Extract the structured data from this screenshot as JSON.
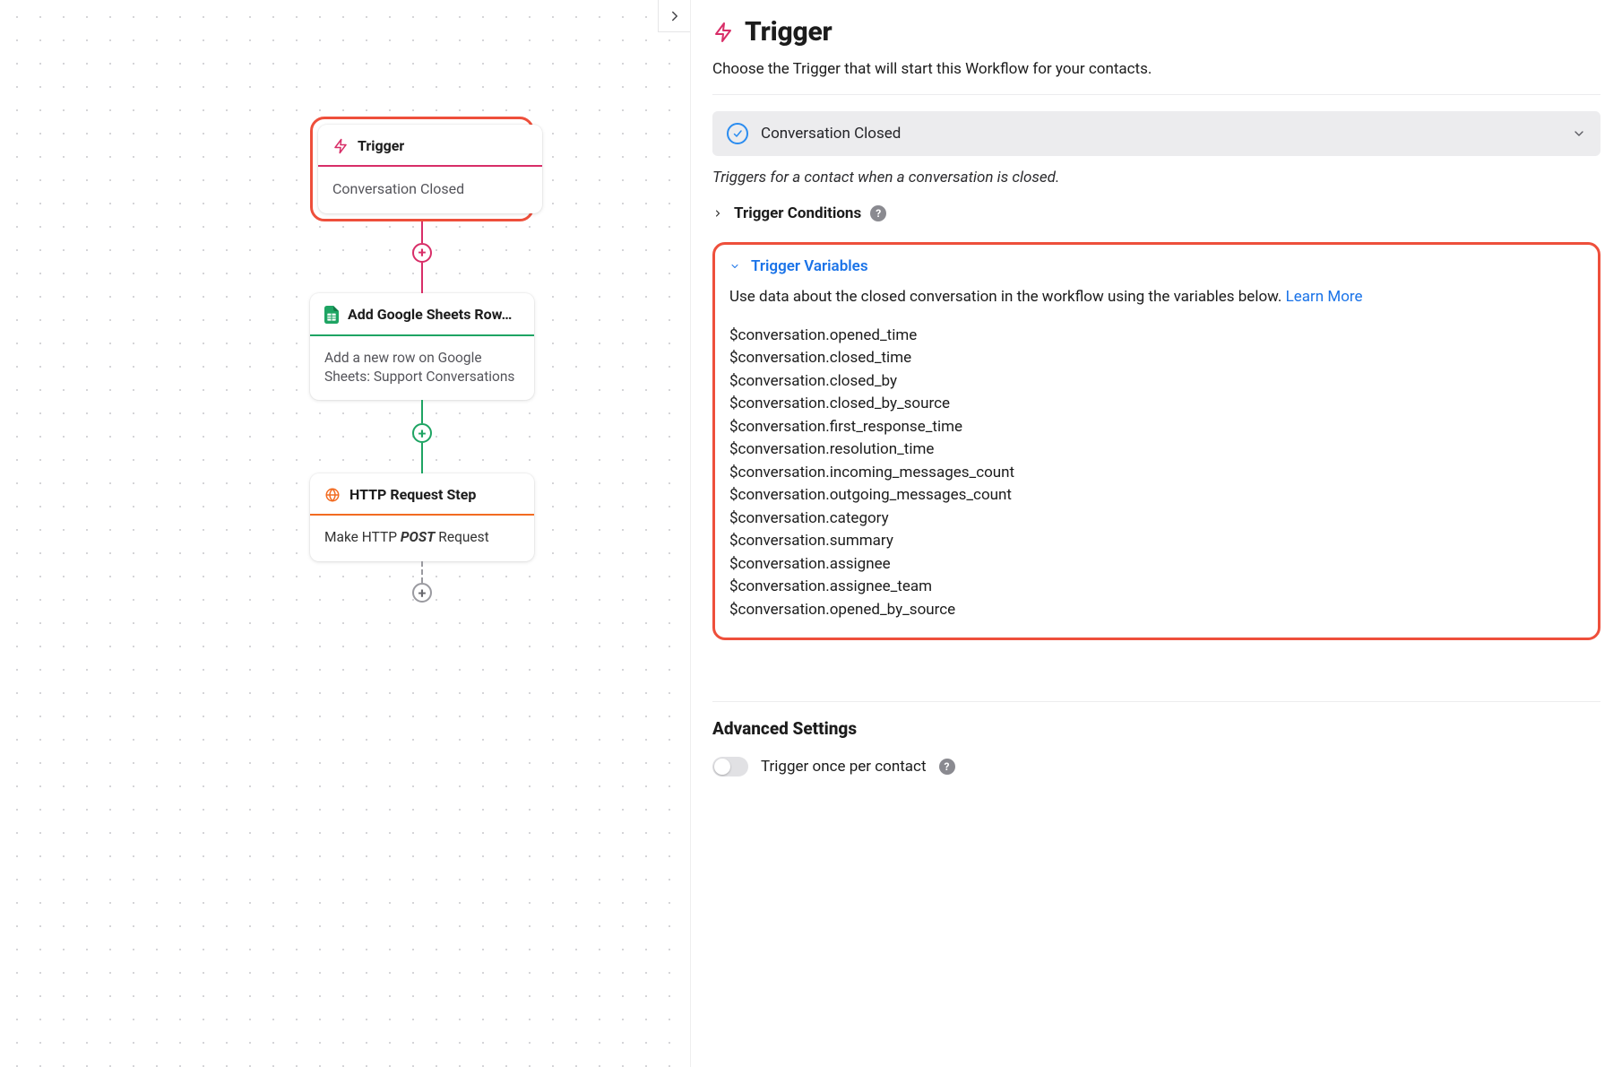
{
  "sidebar": {
    "title": "Trigger",
    "description": "Choose the Trigger that will start this Workflow for your contacts.",
    "selected_trigger": "Conversation Closed",
    "trigger_hint": "Triggers for a contact when a conversation is closed.",
    "conditions_label": "Trigger Conditions",
    "variables_label": "Trigger Variables",
    "variables_intro": "Use data about the closed conversation in the workflow using the variables below. ",
    "learn_more": "Learn More",
    "variables": [
      "$conversation.opened_time",
      "$conversation.closed_time",
      "$conversation.closed_by",
      "$conversation.closed_by_source",
      "$conversation.first_response_time",
      "$conversation.resolution_time",
      "$conversation.incoming_messages_count",
      "$conversation.outgoing_messages_count",
      "$conversation.category",
      "$conversation.summary",
      "$conversation.assignee",
      "$conversation.assignee_team",
      "$conversation.opened_by_source"
    ],
    "advanced_title": "Advanced Settings",
    "once_label": "Trigger once per contact"
  },
  "canvas": {
    "trigger": {
      "label": "Trigger",
      "value": "Conversation Closed"
    },
    "sheets": {
      "title": "Add Google Sheets Row…",
      "body": "Add a new row on Google Sheets: Support Conversations"
    },
    "http": {
      "title": "HTTP Request Step",
      "body_prefix": "Make HTTP ",
      "body_method": "POST",
      "body_suffix": " Request"
    }
  }
}
